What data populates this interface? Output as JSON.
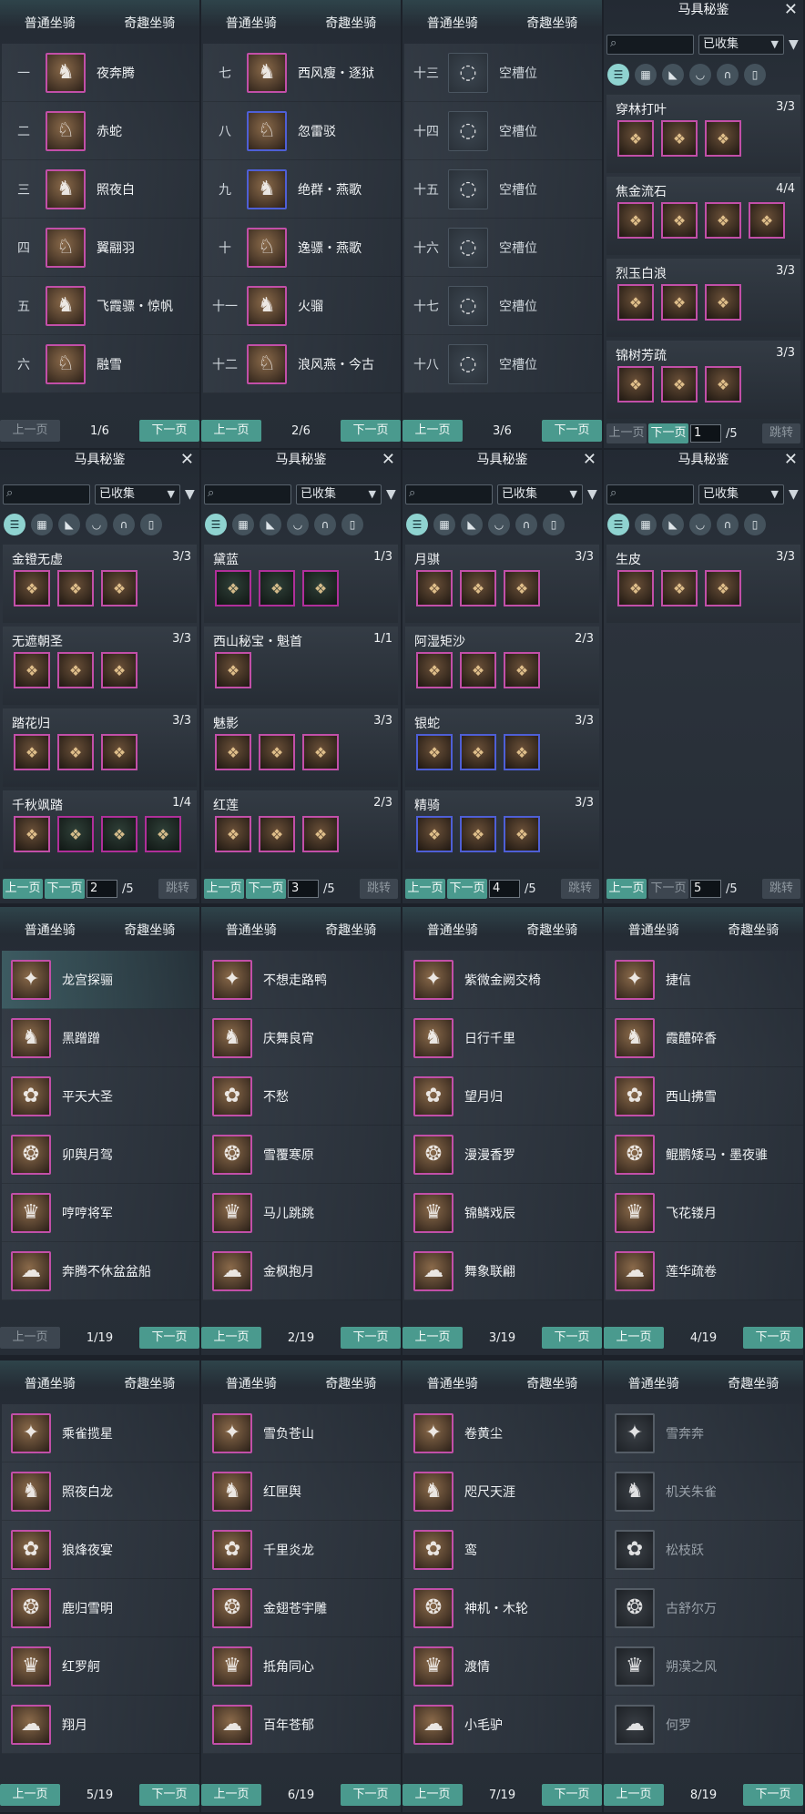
{
  "tabs": {
    "normal": "普通坐骑",
    "special": "奇趣坐骑"
  },
  "pager": {
    "prev": "上一页",
    "next": "下一页",
    "jump": "跳转"
  },
  "slot_pages": [
    {
      "page": "1/6",
      "rows": [
        {
          "num": "一",
          "name": "夜奔腾",
          "icon": "horse-icon"
        },
        {
          "num": "二",
          "name": "赤蛇",
          "icon": "horse-icon"
        },
        {
          "num": "三",
          "name": "照夜白",
          "icon": "horse-icon"
        },
        {
          "num": "四",
          "name": "翼翮羽",
          "icon": "horse-icon"
        },
        {
          "num": "五",
          "name": "飞霞骠・惊帆",
          "icon": "horse-icon"
        },
        {
          "num": "六",
          "name": "融雪",
          "icon": "horse-icon"
        }
      ]
    },
    {
      "page": "2/6",
      "rows": [
        {
          "num": "七",
          "name": "西风瘦・逐狱",
          "icon": "horse-icon"
        },
        {
          "num": "八",
          "name": "忽雷驳",
          "icon": "horse-icon"
        },
        {
          "num": "九",
          "name": "绝群・燕歌",
          "icon": "horse-icon"
        },
        {
          "num": "十",
          "name": "逸骠・燕歌",
          "icon": "horse-icon"
        },
        {
          "num": "十一",
          "name": "火骝",
          "icon": "horse-icon"
        },
        {
          "num": "十二",
          "name": "浪风燕・今古",
          "icon": "horse-icon"
        }
      ]
    },
    {
      "page": "3/6",
      "rows": [
        {
          "num": "十三",
          "name": "空槽位",
          "icon": "empty-slot-icon"
        },
        {
          "num": "十四",
          "name": "空槽位",
          "icon": "empty-slot-icon"
        },
        {
          "num": "十五",
          "name": "空槽位",
          "icon": "empty-slot-icon"
        },
        {
          "num": "十六",
          "name": "空槽位",
          "icon": "empty-slot-icon"
        },
        {
          "num": "十七",
          "name": "空槽位",
          "icon": "empty-slot-icon"
        },
        {
          "num": "十八",
          "name": "空槽位",
          "icon": "empty-slot-icon"
        }
      ]
    }
  ],
  "gear": {
    "title": "马具秘鉴",
    "filter_value": "已收集",
    "close_icon": "close-icon",
    "category_icons": [
      "list-icon",
      "grid-icon",
      "head-gear-icon",
      "chest-gear-icon",
      "horseshoe-icon",
      "saddle-icon"
    ],
    "pages": [
      {
        "page_input": "1",
        "total": "/5",
        "sets": [
          {
            "name": "穿林打叶",
            "count": "3/3",
            "items": 3
          },
          {
            "name": "焦金流石",
            "count": "4/4",
            "items": 4
          },
          {
            "name": "烈玉白浪",
            "count": "3/3",
            "items": 3
          },
          {
            "name": "锦树芳疏",
            "count": "3/3",
            "items": 3
          }
        ]
      },
      {
        "page_input": "2",
        "total": "/5",
        "sets": [
          {
            "name": "金镫无虚",
            "count": "3/3",
            "items": 3
          },
          {
            "name": "无遮朝圣",
            "count": "3/3",
            "items": 3
          },
          {
            "name": "踏花归",
            "count": "3/3",
            "items": 3
          },
          {
            "name": "千秋飒踏",
            "count": "1/4",
            "items": 4
          }
        ]
      },
      {
        "page_input": "3",
        "total": "/5",
        "sets": [
          {
            "name": "黛蓝",
            "count": "1/3",
            "items": 3
          },
          {
            "name": "西山秘宝・魁首",
            "count": "1/1",
            "items": 1
          },
          {
            "name": "魅影",
            "count": "3/3",
            "items": 3
          },
          {
            "name": "红莲",
            "count": "2/3",
            "items": 3
          }
        ]
      },
      {
        "page_input": "4",
        "total": "/5",
        "sets": [
          {
            "name": "月骐",
            "count": "3/3",
            "items": 3
          },
          {
            "name": "阿湿矩沙",
            "count": "2/3",
            "items": 3
          },
          {
            "name": "银蛇",
            "count": "3/3",
            "items": 3
          },
          {
            "name": "精骑",
            "count": "3/3",
            "items": 3
          }
        ]
      },
      {
        "page_input": "5",
        "total": "/5",
        "sets": [
          {
            "name": "生皮",
            "count": "3/3",
            "items": 3
          }
        ]
      }
    ]
  },
  "special_pages": [
    {
      "page": "1/19",
      "rows": [
        "龙宫探骊",
        "黑蹭蹭",
        "平天大圣",
        "卯舆月驾",
        "哼哼将军",
        "奔腾不休盆盆船"
      ]
    },
    {
      "page": "2/19",
      "rows": [
        "不想走路鸭",
        "庆舞良宵",
        "不愁",
        "雪覆寒原",
        "马儿跳跳",
        "金枫抱月"
      ]
    },
    {
      "page": "3/19",
      "rows": [
        "紫微金阙交椅",
        "日行千里",
        "望月归",
        "漫漫香罗",
        "锦鳞戏辰",
        "舞象联翩"
      ]
    },
    {
      "page": "4/19",
      "rows": [
        "捷信",
        "霞醴碎香",
        "西山拂雪",
        "鲲鹏矮马・墨夜骓",
        "飞花镂月",
        "莲华疏卷"
      ]
    },
    {
      "page": "5/19",
      "rows": [
        "乘雀揽星",
        "照夜白龙",
        "狼烽夜宴",
        "鹿归雪明",
        "红罗舸",
        "翔月"
      ]
    },
    {
      "page": "6/19",
      "rows": [
        "雪负苍山",
        "红匣舆",
        "千里炎龙",
        "金翅苍宇雕",
        "抵角同心",
        "百年苍郁"
      ]
    },
    {
      "page": "7/19",
      "rows": [
        "卷黄尘",
        "咫尺天涯",
        "鸾",
        "神机・木轮",
        "渡情",
        "小毛驴"
      ]
    },
    {
      "page": "8/19",
      "rows": [
        "雪奔奔",
        "机关朱雀",
        "松枝跃",
        "古舒尔万",
        "朔漠之风",
        "何罗"
      ]
    }
  ],
  "colors": {
    "accent": "#4a9a8e",
    "purple_frame": "#c24fa8",
    "blue_frame": "#4e5fd6",
    "selected_category": "#8fd3d0"
  }
}
